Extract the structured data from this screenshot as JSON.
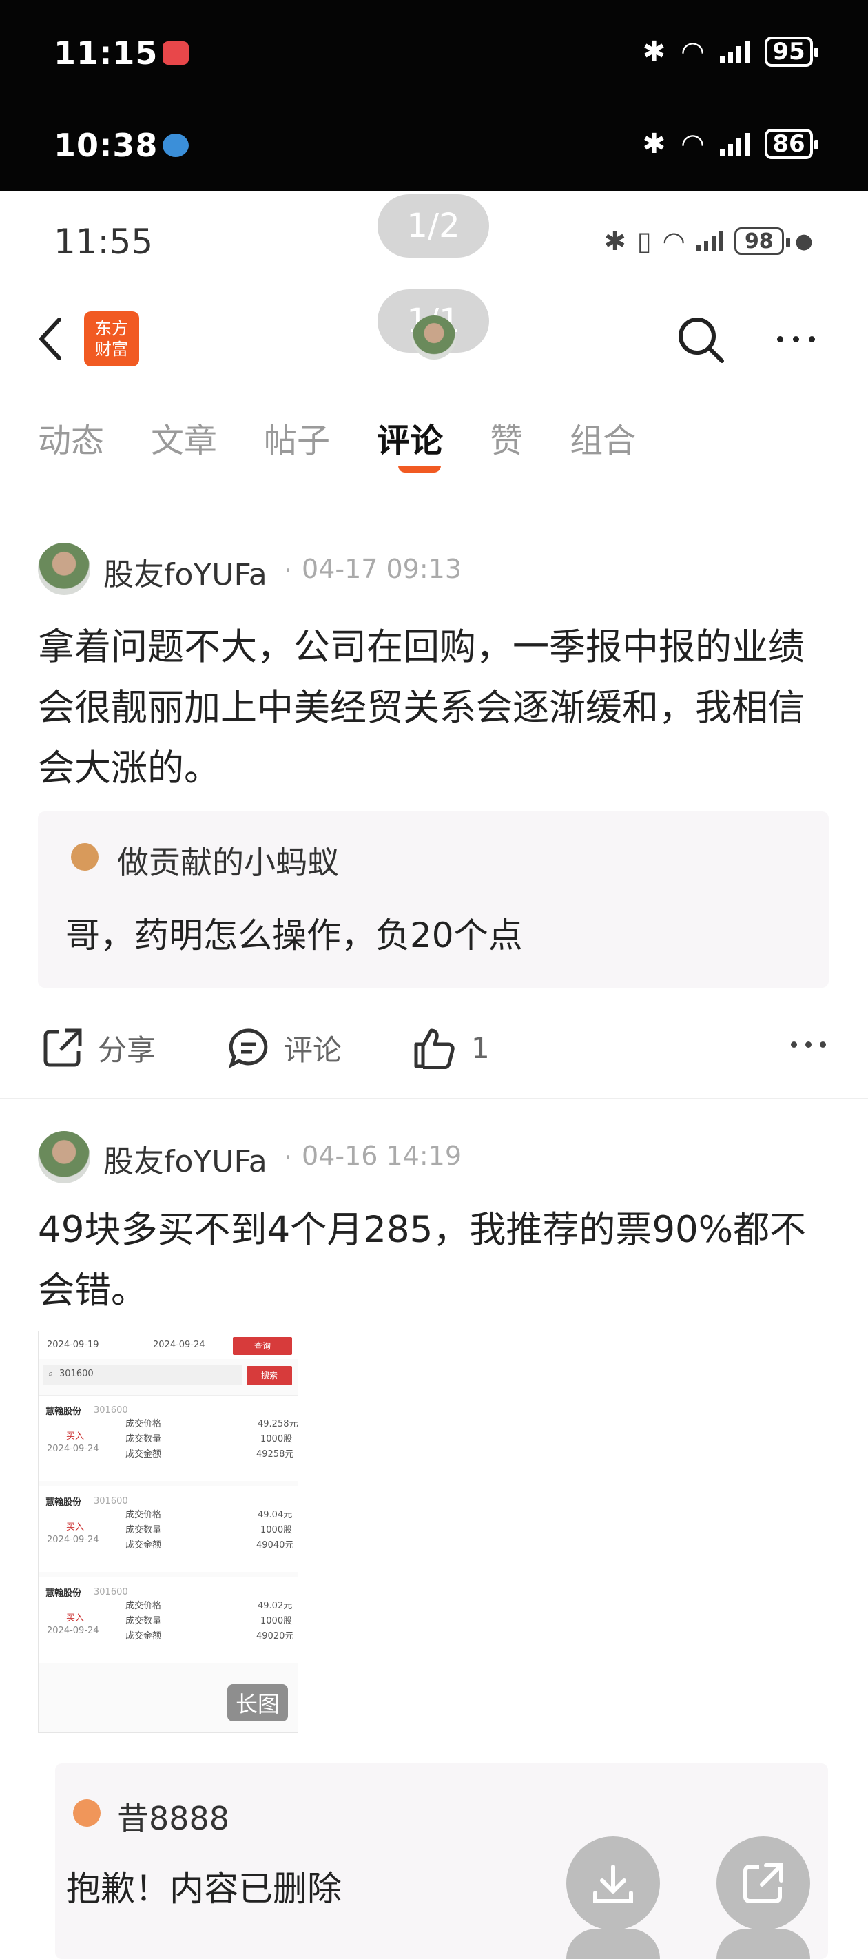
{
  "status_outer_1": {
    "time": "11:15",
    "battery": "95"
  },
  "status_outer_2": {
    "time": "10:38",
    "battery": "86"
  },
  "status_inner": {
    "time": "11:55",
    "battery": "98"
  },
  "pager_top": "1/2",
  "pager_mid": "1/1",
  "app": {
    "logo_text": "东方\n财富",
    "brand_color": "#f15a22"
  },
  "tabs": [
    "动态",
    "文章",
    "帖子",
    "评论",
    "赞",
    "组合"
  ],
  "active_tab": "评论",
  "posts": [
    {
      "user": "股友foYUFa",
      "time": "04-17 09:13",
      "text": "拿着问题不大，公司在回购，一季报中报的业绩会很靓丽加上中美经贸关系会逐渐缓和，我相信会大涨的。",
      "reply_user": "做贡献的小蚂蚁",
      "reply_text": "哥，药明怎么操作，负20个点",
      "actions": {
        "share": "分享",
        "comment": "评论",
        "like_count": "1"
      }
    },
    {
      "user": "股友foYUFa",
      "time": "04-16 14:19",
      "text": "49块多买不到4个月285，我推荐的票90%都不会错。",
      "image_badge": "长图",
      "reply_user": "昔8888",
      "reply_text": "抱歉！内容已删除"
    }
  ],
  "thumb": {
    "date_from": "2024-09-19",
    "date_to": "2024-09-24",
    "query_btn": "查询",
    "code": "301600",
    "search_btn": "搜索",
    "entries": [
      {
        "name": "慧翰股份",
        "code": "301600",
        "side": "买入",
        "date": "2024-09-24",
        "price_label": "成交价格",
        "price": "49.258元",
        "qty_label": "成交数量",
        "qty": "1000股",
        "amt_label": "成交金额",
        "amt": "49258元"
      },
      {
        "name": "慧翰股份",
        "code": "301600",
        "side": "买入",
        "date": "2024-09-24",
        "price_label": "成交价格",
        "price": "49.04元",
        "qty_label": "成交数量",
        "qty": "1000股",
        "amt_label": "成交金额",
        "amt": "49040元"
      },
      {
        "name": "慧翰股份",
        "code": "301600",
        "side": "买入",
        "date": "2024-09-24",
        "price_label": "成交价格",
        "price": "49.02元",
        "qty_label": "成交数量",
        "qty": "1000股",
        "amt_label": "成交金额",
        "amt": "49020元"
      }
    ]
  }
}
